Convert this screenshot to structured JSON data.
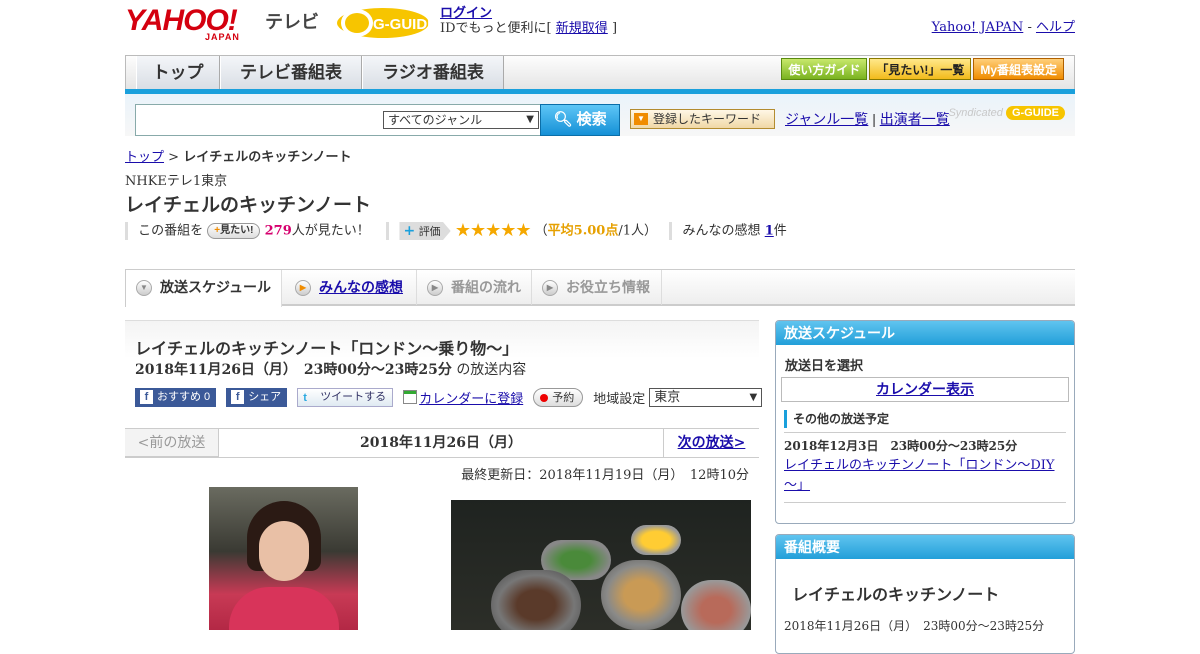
{
  "header": {
    "logo_text": "YAHOO!",
    "logo_sub": "JAPAN",
    "tv_label": "テレビ",
    "gguide_logo": "G-GUIDE",
    "login_label": "ログイン",
    "login_note_prefix": "IDでもっと便利に[",
    "signup_label": "新規取得",
    "login_note_suffix": "]",
    "yahoo_japan_link": "Yahoo! JAPAN",
    "sep": "-",
    "help_link": "ヘルプ"
  },
  "nav": {
    "tabs": [
      "トップ",
      "テレビ番組表",
      "ラジオ番組表"
    ],
    "guides": [
      "使い方ガイド",
      "「見たい!」一覧",
      "My番組表設定"
    ]
  },
  "search": {
    "genre_selected": "すべてのジャンル",
    "search_button": "検索",
    "keyword_button": "登録したキーワード",
    "genre_list_link": "ジャンル一覧",
    "divider": "|",
    "performer_list_link": "出演者一覧",
    "syndicated": "Syndicated",
    "syndicated_logo": "G-GUIDE"
  },
  "breadcrumb": {
    "home": "トップ",
    "sep": ">",
    "current": "レイチェルのキッチンノート"
  },
  "program": {
    "channel": "NHKEテレ1東京",
    "title": "レイチェルのキッチンノート",
    "want_prefix": "この番組を",
    "want_button": "見たい!",
    "want_count": "279",
    "want_suffix": "人が見たい！",
    "rating_label": "評価",
    "stars": "★★★★★",
    "rating_open": "（",
    "rating_avg": "平均5.00点",
    "rating_people": "/1人）",
    "reviews_prefix": "みんなの感想",
    "reviews_count": "1",
    "reviews_suffix": "件"
  },
  "tabs": {
    "schedule": "放送スケジュール",
    "reviews": "みんなの感想",
    "flow": "番組の流れ",
    "info": "お役立ち情報"
  },
  "episode": {
    "title": "レイチェルのキッチンノート「ロンドン～乗り物～」",
    "date": "2018年11月26日（月）　23時00分～23時25分",
    "date_suffix": "の放送内容",
    "fb_recommend": "おすすめ 0",
    "fb_share": "シェア",
    "tweet": "ツイートする",
    "calendar": "カレンダーに登録",
    "reserve": "予約",
    "region_label": "地域設定",
    "region_value": "東京"
  },
  "pager": {
    "prev": "<前の放送",
    "current": "2018年11月26日（月）",
    "next": "次の放送>"
  },
  "updated": "最終更新日：2018年11月19日（月）　12時10分",
  "sidebar": {
    "schedule_title": "放送スケジュール",
    "select_date": "放送日を選択",
    "calendar_button": "カレンダー表示",
    "other_title": "その他の放送予定",
    "other_date": "2018年12月3日　23時00分～23時25分",
    "other_link": "レイチェルのキッチンノート「ロンドン～DIY～」",
    "summary_title": "番組概要",
    "summary_program": "レイチェルのキッチンノート",
    "summary_date": "2018年11月26日（月）　23時00分～23時25分"
  },
  "icons": {
    "search": "search-icon",
    "dropdown": "chevron-down-icon",
    "tab_bullet": "play-circle-icon",
    "calendar": "calendar-icon",
    "record": "record-icon"
  },
  "colors": {
    "accent_blue": "#1aa0dc",
    "brand_red": "#d4000f",
    "star": "#f5a800",
    "want_count": "#d6006e"
  }
}
